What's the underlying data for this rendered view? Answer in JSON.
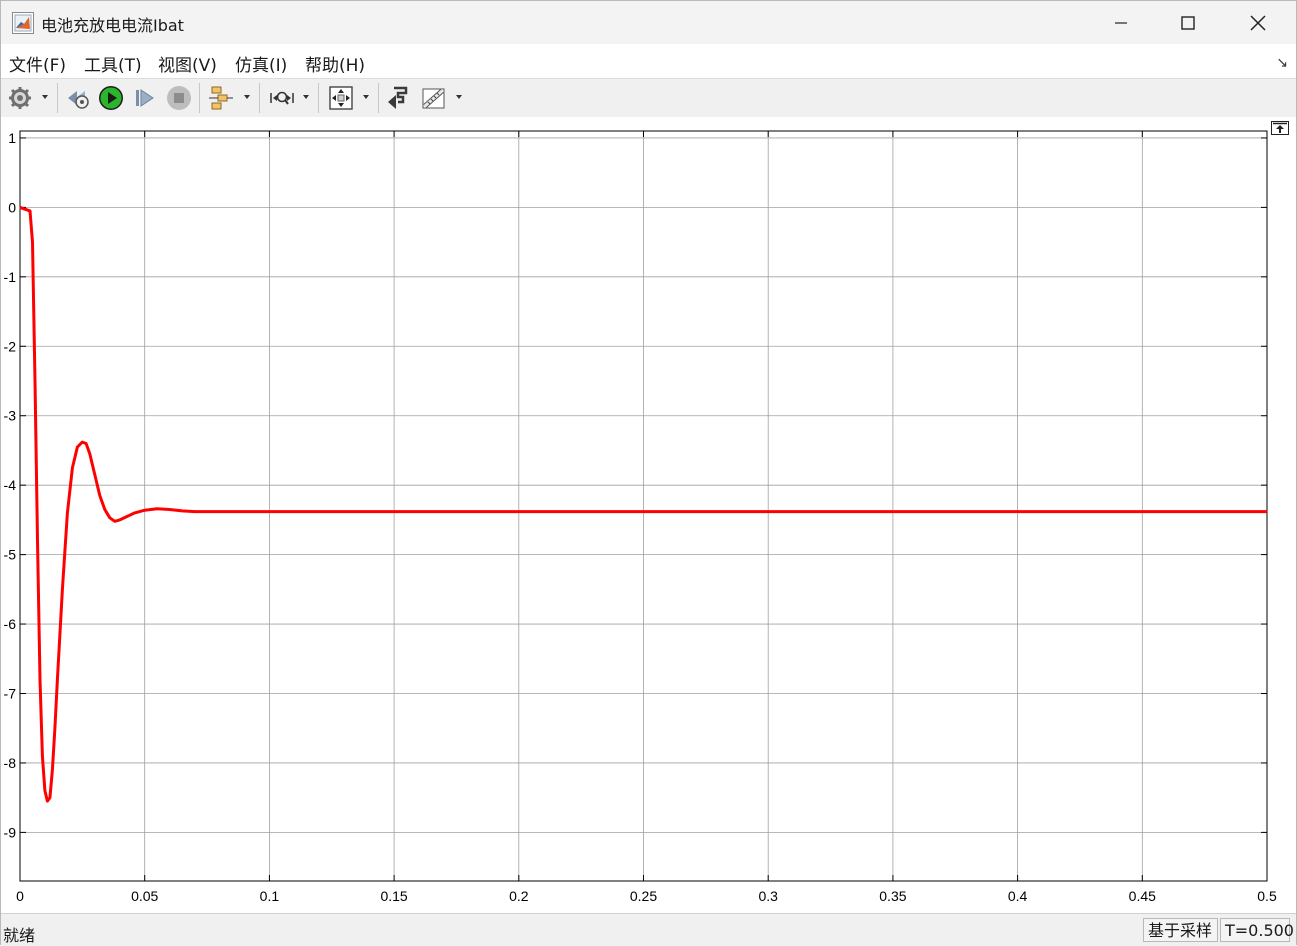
{
  "window": {
    "title": "电池充放电电流Ibat"
  },
  "menu": {
    "items": [
      "文件(F)",
      "工具(T)",
      "视图(V)",
      "仿真(I)",
      "帮助(H)"
    ]
  },
  "toolbar": {
    "icons": [
      "gear-icon",
      "step-back-icon",
      "run-icon",
      "step-forward-icon",
      "stop-icon",
      "signal-select-icon",
      "zoom-icon",
      "fit-to-view-icon",
      "write-to-workspace-icon",
      "measure-icon"
    ]
  },
  "colors": {
    "trace": "#ff0000",
    "grid": "#a0a0a0",
    "axes": "#000000",
    "run_green": "#2bb52b"
  },
  "status": {
    "left": "就绪",
    "mode": "基于采样",
    "time": "T=0.500"
  },
  "chart_data": {
    "type": "line",
    "title": "",
    "xlabel": "",
    "ylabel": "",
    "xlim": [
      0,
      0.5
    ],
    "ylim": [
      -9.7,
      1.1
    ],
    "xticks": [
      0,
      0.05,
      0.1,
      0.15,
      0.2,
      0.25,
      0.3,
      0.35,
      0.4,
      0.45,
      0.5
    ],
    "xtick_labels": [
      "0",
      "0.05",
      "0.1",
      "0.15",
      "0.2",
      "0.25",
      "0.3",
      "0.35",
      "0.4",
      "0.45",
      "0.5"
    ],
    "yticks": [
      1,
      0,
      -1,
      -2,
      -3,
      -4,
      -5,
      -6,
      -7,
      -8,
      -9
    ],
    "ytick_labels": [
      "1",
      "0",
      "-1",
      "-2",
      "-3",
      "-4",
      "-5",
      "-6",
      "-7",
      "-8",
      "-9"
    ],
    "grid": true,
    "series": [
      {
        "x": [
          0,
          0.004,
          0.005,
          0.006,
          0.007,
          0.008,
          0.009,
          0.01,
          0.011,
          0.012,
          0.013,
          0.014,
          0.015,
          0.017,
          0.019,
          0.021,
          0.023,
          0.025,
          0.0265,
          0.028,
          0.03,
          0.032,
          0.034,
          0.036,
          0.038,
          0.04,
          0.043,
          0.046,
          0.05,
          0.055,
          0.06,
          0.065,
          0.07,
          0.08,
          0.1,
          0.2,
          0.3,
          0.4,
          0.5
        ],
        "y": [
          0,
          -0.05,
          -0.5,
          -2.5,
          -4.8,
          -6.8,
          -7.9,
          -8.4,
          -8.55,
          -8.5,
          -8.1,
          -7.5,
          -6.8,
          -5.5,
          -4.4,
          -3.75,
          -3.45,
          -3.38,
          -3.4,
          -3.55,
          -3.85,
          -4.15,
          -4.35,
          -4.47,
          -4.52,
          -4.5,
          -4.45,
          -4.4,
          -4.36,
          -4.34,
          -4.35,
          -4.37,
          -4.38,
          -4.38,
          -4.38,
          -4.38,
          -4.38,
          -4.38,
          -4.38
        ]
      }
    ]
  }
}
